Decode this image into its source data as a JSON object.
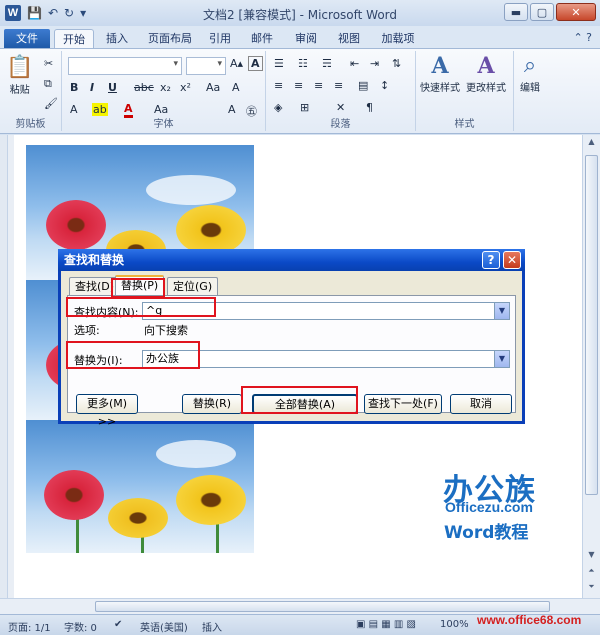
{
  "window": {
    "title": "文档2 [兼容模式] - Microsoft Word",
    "app_icon": "W"
  },
  "tabs": [
    {
      "label": "文件"
    },
    {
      "label": "开始"
    },
    {
      "label": "插入"
    },
    {
      "label": "页面布局"
    },
    {
      "label": "引用"
    },
    {
      "label": "邮件"
    },
    {
      "label": "审阅"
    },
    {
      "label": "视图"
    },
    {
      "label": "加载项"
    }
  ],
  "ribbon": {
    "paste_label": "粘贴",
    "clipboard_group": "剪贴板",
    "font_group": "字体",
    "paragraph_group": "段落",
    "styles_group": "样式",
    "quick_styles": "快速样式",
    "change_styles": "更改样式",
    "edit_label": "编辑",
    "bold": "B",
    "italic": "I",
    "underline": "U",
    "strike": "abc",
    "sub": "x₂",
    "sup": "x²"
  },
  "dialog": {
    "title": "查找和替换",
    "tabs": [
      {
        "label": "查找(D)"
      },
      {
        "label": "替换(P)"
      },
      {
        "label": "定位(G)"
      }
    ],
    "find_label": "查找内容(N):",
    "find_value": "^g",
    "options_label": "选项:",
    "options_value": "向下搜索",
    "replace_label": "替换为(I):",
    "replace_value": "办公族",
    "buttons": {
      "more": "更多(M) >>",
      "replace": "替换(R)",
      "replace_all": "全部替换(A)",
      "find_next": "查找下一处(F)",
      "cancel": "取消"
    }
  },
  "statusbar": {
    "page": "页面: 1/1",
    "words": "字数: 0",
    "language": "英语(美国)",
    "mode": "插入",
    "zoom": "100%"
  },
  "watermark": {
    "logo": "办公族",
    "site": "Officezu.com",
    "word": "Word教程",
    "url": "www.office68.com"
  },
  "colors": {
    "highlight": "#e0141e",
    "dialog_title": "#0b4ac7",
    "brand": "#1b6ec2"
  }
}
